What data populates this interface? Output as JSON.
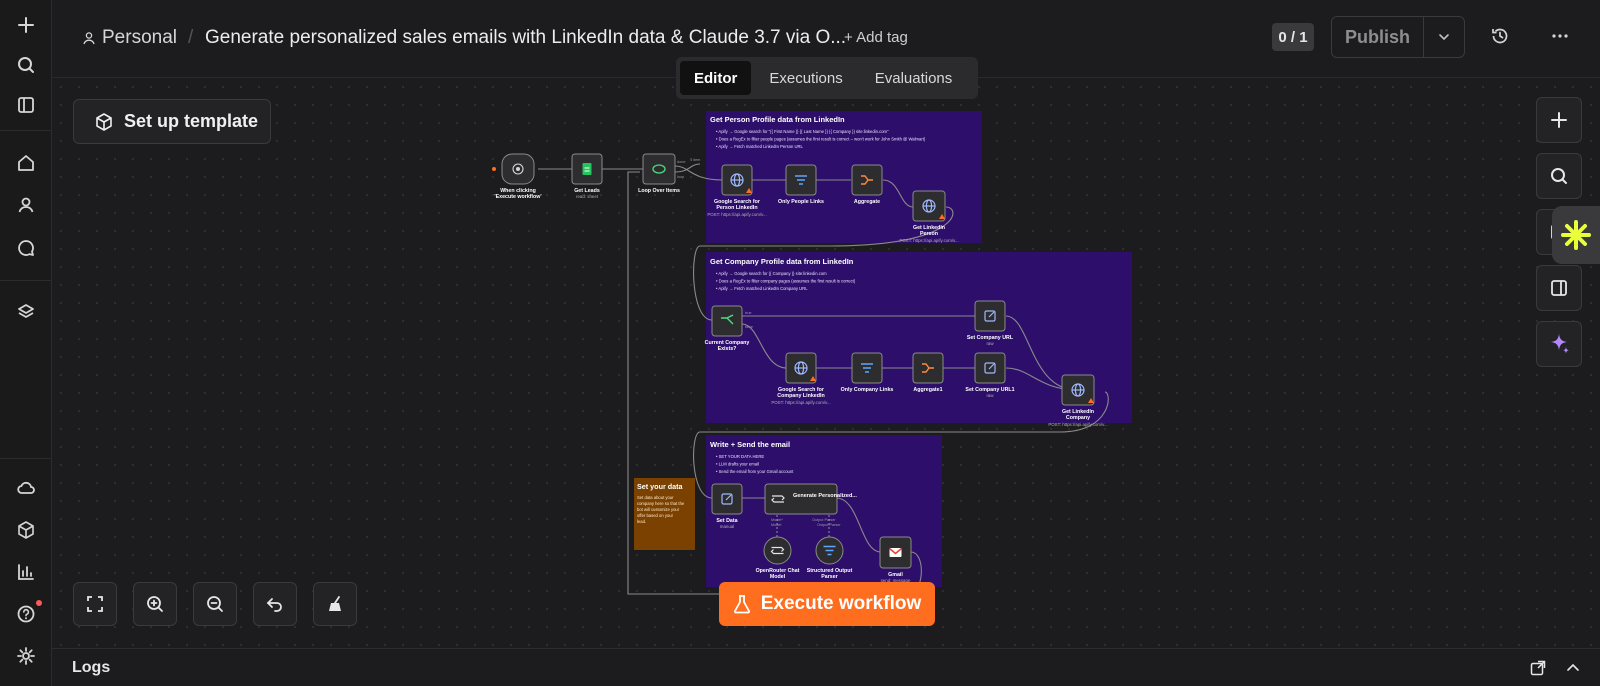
{
  "header": {
    "project": "Personal",
    "workflow_title": "Generate personalized sales emails with LinkedIn data & Claude 3.7 via O...",
    "add_tag": "+ Add tag",
    "counter": "0 / 1",
    "publish": "Publish"
  },
  "tabs": [
    "Editor",
    "Executions",
    "Evaluations"
  ],
  "active_tab": "Editor",
  "canvas": {
    "setup_template": "Set up template",
    "execute_workflow": "Execute workflow",
    "sticky_notes": {
      "person": {
        "title": "Get Person Profile data from LinkedIn",
        "lines": [
          "Apify → Google search for \"{{ First Name }} {{ Last Name }} {{ Company }} site:linkedin.com\"",
          "Does a RegEx to filter people pages (assumes the first result is correct – won't work for John Smith @ Walmart)",
          "Apify → Fetch matched LinkedIn Person URL"
        ]
      },
      "company": {
        "title": "Get Company Profile data from LinkedIn",
        "lines": [
          "Apify → Google search for {{ Company }} site:linkedin.com",
          "Does a RegEx to filter company pages (assumes the first result is correct)",
          "Apify → Fetch matched LinkedIn Company URL"
        ]
      },
      "email": {
        "title": "Write + Send the email",
        "lines": [
          "SET YOUR DATA HERE",
          "LLM drafts your email",
          "Send the email from your Gmail account"
        ]
      },
      "data": {
        "title": "Set your data",
        "body": "Set data about your company here so that the bot will customize your offer based on your lead."
      }
    },
    "nodes": {
      "trigger": "When clicking 'Execute workflow'",
      "get_leads": "Get Leads",
      "get_leads_sub": "read: sheet",
      "loop": "Loop Over Items",
      "google_person": "Google Search for Person LinkedIn",
      "google_person_sub": "POST: https://api.apify.com/v...",
      "only_people": "Only People Links",
      "aggregate": "Aggregate",
      "get_person": "Get LinkedIn Person",
      "get_person_sub": "POST: https://api.apify.com/v...",
      "company_exists": "Current Company Exists?",
      "true_label": "true",
      "false_label": "false",
      "done_label": "done",
      "loop_label": "loop",
      "items_label": "1 item",
      "set_company_url": "Set Company URL",
      "set_company_url_sub": "raw",
      "google_company": "Google Search for Company LinkedIn",
      "google_company_sub": "POST: https://api.apify.com/v...",
      "only_company": "Only Company Links",
      "aggregate1": "Aggregate1",
      "set_company_url1": "Set Company URL1",
      "set_company_url1_sub": "raw",
      "get_company": "Get LinkedIn Company",
      "get_company_sub": "POST: https://api.apify.com/v...",
      "set_data": "Set Data",
      "set_data_sub": "manual",
      "generate": "Generate Personalized...",
      "chat_model_label": "Model*",
      "chat_model_sub": "Model",
      "output_parser_label": "Output Parser",
      "openrouter": "OpenRouter Chat Model",
      "structured": "Structured Output Parser",
      "gmail": "Gmail",
      "gmail_sub": "send: message"
    }
  },
  "logs": "Logs",
  "colors": {
    "accent": "#ff6d1f",
    "sticky_purple": "#2d0f6b",
    "sticky_brown": "#7a4100"
  }
}
